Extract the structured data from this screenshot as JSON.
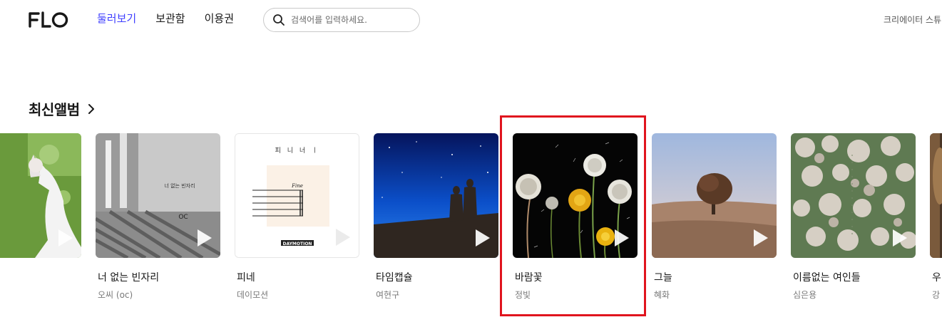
{
  "header": {
    "logo_text": "FLO",
    "nav": [
      {
        "label": "둘러보기",
        "active": true
      },
      {
        "label": "보관함",
        "active": false
      },
      {
        "label": "이용권",
        "active": false
      }
    ],
    "search_placeholder": "검색어를 입력하세요.",
    "creator_link": "크리에이터 스튜"
  },
  "section": {
    "title": "최신앨범"
  },
  "albums": [
    {
      "title": "",
      "artist": ""
    },
    {
      "title": "너 없는 빈자리",
      "artist": "오씨 (oc)",
      "cover_text": "너 없는 빈자리",
      "cover_sub": "OC"
    },
    {
      "title": "피네",
      "artist": "데이모션",
      "cover_text": "피 니 너 ㅣ",
      "cover_sub": "Fine",
      "cover_brand": "DAYMOTION"
    },
    {
      "title": "타임캡슐",
      "artist": "여현구"
    },
    {
      "title": "바람꽃",
      "artist": "정빛"
    },
    {
      "title": "그늘",
      "artist": "혜화"
    },
    {
      "title": "이름없는 여인들",
      "artist": "심은용"
    },
    {
      "title": "우",
      "artist": "강"
    }
  ],
  "colors": {
    "accent": "#3f3fff",
    "highlight_box": "#e0141e"
  }
}
